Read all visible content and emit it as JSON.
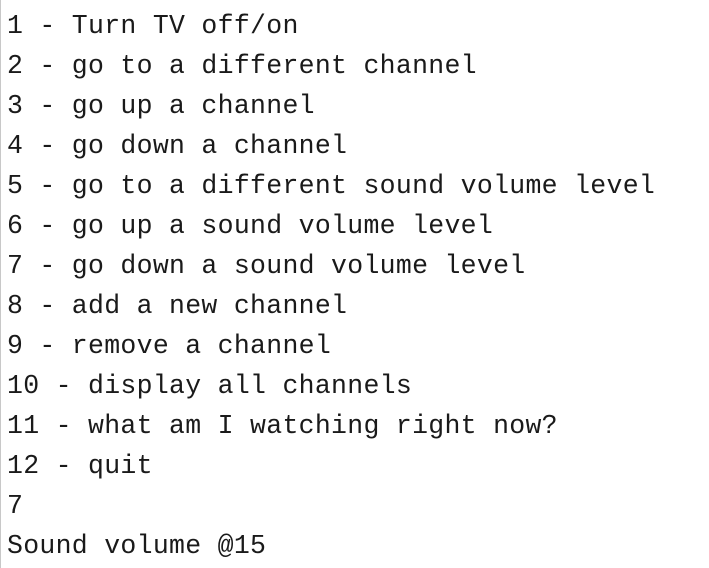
{
  "console": {
    "lines": [
      "1 - Turn TV off/on",
      "2 - go to a different channel",
      "3 - go up a channel",
      "4 - go down a channel",
      "5 - go to a different sound volume level",
      "6 - go up a sound volume level",
      "7 - go down a sound volume level",
      "8 - add a new channel",
      "9 - remove a channel",
      "10 - display all channels",
      "11 - what am I watching right now?",
      "12 - quit",
      "7",
      "Sound volume @15"
    ]
  }
}
